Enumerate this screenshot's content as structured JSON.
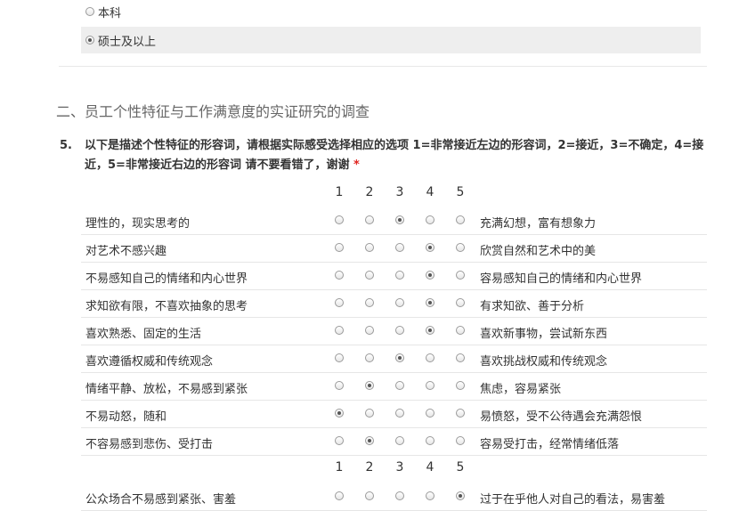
{
  "prev_question": {
    "options": [
      {
        "label": "本科",
        "checked": false
      },
      {
        "label": "硕士及以上",
        "checked": true
      }
    ]
  },
  "section": {
    "title": "二、员工个性特征与工作满意度的实证研究的调查"
  },
  "question": {
    "number": "5.",
    "text": "以下是描述个性特征的形容词，请根据实际感受选择相应的选项 1=非常接近左边的形容词，2=接近，3=不确定，4=接近，5=非常接近右边的形容词 请不要看错了，谢谢",
    "required_mark": "*"
  },
  "scale": [
    "1",
    "2",
    "3",
    "4",
    "5"
  ],
  "rows": [
    {
      "left": "理性的，现实思考的",
      "right": "充满幻想，富有想象力",
      "selected": 3
    },
    {
      "left": "对艺术不感兴趣",
      "right": "欣赏自然和艺术中的美",
      "selected": 4
    },
    {
      "left": "不易感知自己的情绪和内心世界",
      "right": "容易感知自己的情绪和内心世界",
      "selected": 4
    },
    {
      "left": "求知欲有限，不喜欢抽象的思考",
      "right": "有求知欲、善于分析",
      "selected": 4
    },
    {
      "left": "喜欢熟悉、固定的生活",
      "right": "喜欢新事物，尝试新东西",
      "selected": 4
    },
    {
      "left": "喜欢遵循权威和传统观念",
      "right": "喜欢挑战权威和传统观念",
      "selected": 3
    },
    {
      "left": "情绪平静、放松，不易感到紧张",
      "right": "焦虑，容易紧张",
      "selected": 2
    },
    {
      "left": "不易动怒，随和",
      "right": "易愤怒，受不公待遇会充满怨恨",
      "selected": 1
    },
    {
      "left": "不容易感到悲伤、受打击",
      "right": "容易受打击，经常情绪低落",
      "selected": 2
    },
    {
      "left": "公众场合不易感到紧张、害羞",
      "right": "过于在乎他人对自己的看法，易害羞",
      "selected": 5
    }
  ]
}
